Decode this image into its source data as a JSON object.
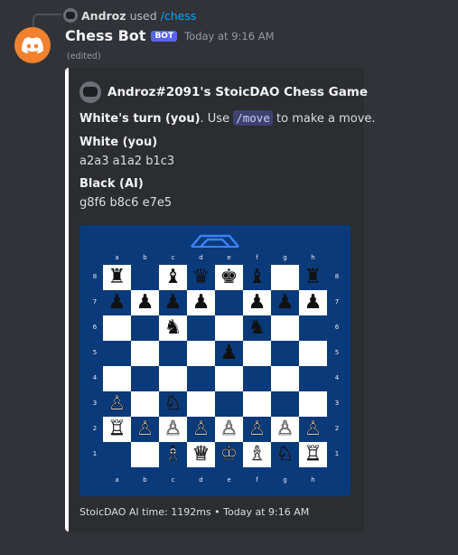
{
  "reply": {
    "username": "Androz",
    "used_text": "used",
    "command": "/chess"
  },
  "message": {
    "bot_name": "Chess Bot",
    "bot_badge": "BOT",
    "timestamp": "Today at 9:16 AM",
    "edited_label": "(edited)"
  },
  "embed": {
    "accent_color": "#ffffff",
    "author": "Androz#2091's StoicDAO Chess Game",
    "turn_bold": "White's turn (you)",
    "turn_mid": ". Use",
    "turn_cmd": "/move",
    "turn_end": "to make a move.",
    "white_label": "White (you)",
    "white_moves": "a2a3 a1a2 b1c3",
    "black_label": "Black (AI)",
    "black_moves": "g8f6 b8c6 e7e5",
    "footer": "StoicDAO AI time: 1192ms • Today at 9:16 AM"
  },
  "board": {
    "files": [
      "a",
      "b",
      "c",
      "d",
      "e",
      "f",
      "g",
      "h"
    ],
    "ranks": [
      "8",
      "7",
      "6",
      "5",
      "4",
      "3",
      "2",
      "1"
    ],
    "dark_color": "#0b3a7a",
    "light_color": "#ffffff",
    "rows": [
      [
        "♜",
        "",
        "♝",
        "♛",
        "♚",
        "♝",
        "",
        "♜"
      ],
      [
        "♟",
        "♟",
        "♟",
        "♟",
        "",
        "♟",
        "♟",
        "♟"
      ],
      [
        "",
        "",
        "♞",
        "",
        "",
        "♞",
        "",
        ""
      ],
      [
        "",
        "",
        "",
        "",
        "♟",
        "",
        "",
        ""
      ],
      [
        "",
        "",
        "",
        "",
        "",
        "",
        "",
        ""
      ],
      [
        "♙",
        "",
        "♘",
        "",
        "",
        "",
        "",
        ""
      ],
      [
        "♖",
        "♙",
        "♙",
        "♙",
        "♙",
        "♙",
        "♙",
        "♙"
      ],
      [
        "",
        "",
        "♗",
        "♕",
        "♔",
        "♗",
        "♘",
        "♖"
      ]
    ]
  }
}
